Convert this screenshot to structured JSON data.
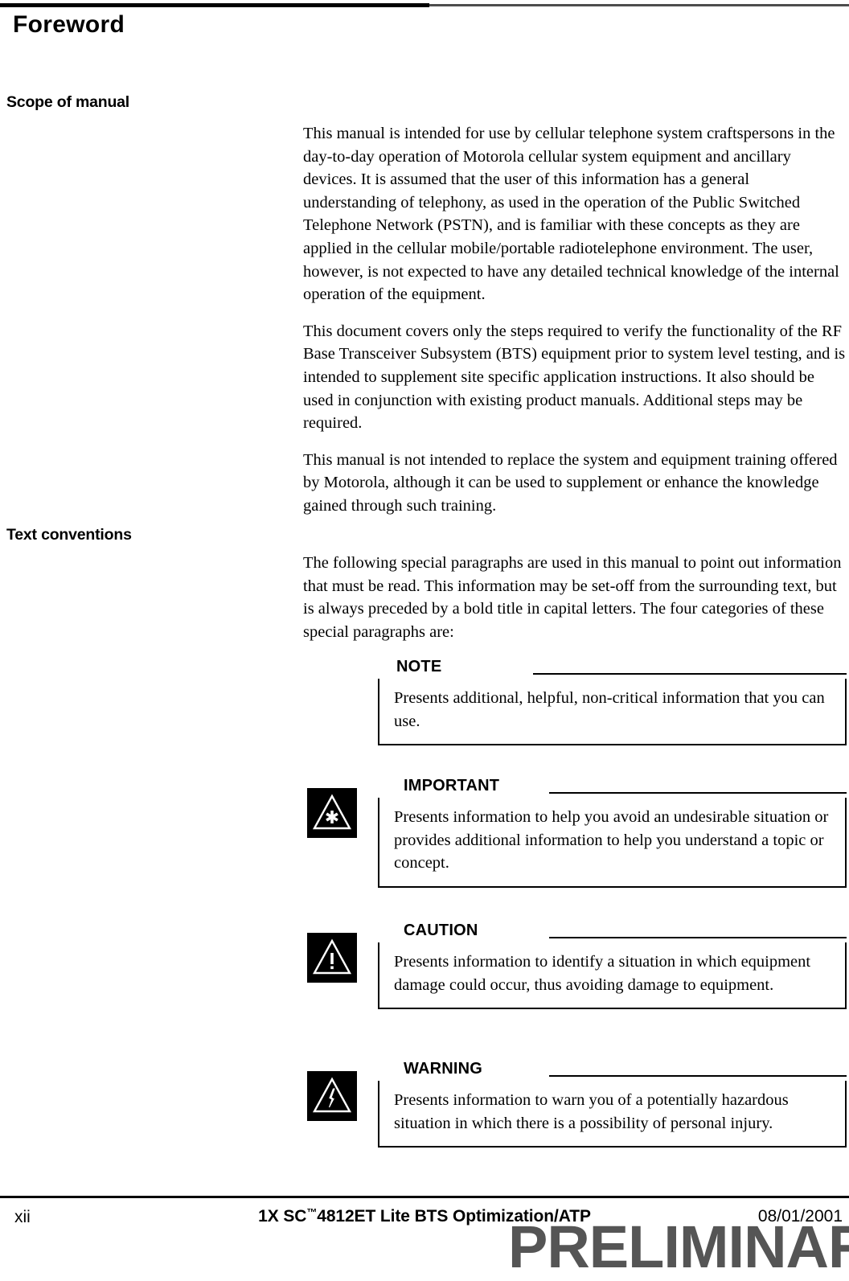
{
  "page": {
    "title": "Foreword",
    "page_number": "xii"
  },
  "sections": [
    {
      "heading": "Scope of manual",
      "paragraphs": [
        "This manual is intended for use by cellular telephone system craftspersons in the day-to-day operation of Motorola cellular system equipment and ancillary devices. It is assumed that the user of this information has a general understanding of telephony, as used in the operation of the Public Switched Telephone Network (PSTN), and is familiar with these concepts as they are applied in the cellular mobile/portable radiotelephone environment. The user, however, is not expected to have any detailed technical knowledge of the internal operation of the equipment.",
        "This document covers only the steps required to verify the functionality of the RF Base Transceiver Subsystem (BTS) equipment prior to system level testing, and is intended to supplement site specific application instructions. It also should be used in conjunction with existing product manuals. Additional steps may be required.",
        "This manual is not intended to replace the system and equipment training offered by Motorola, although it can be used to supplement or enhance the knowledge gained through such training."
      ]
    },
    {
      "heading": "Text conventions",
      "paragraphs": [
        "The following special paragraphs are used in this manual to point out information that must be read. This information may be set-off from the surrounding text, but is always preceded by a bold title in capital letters. The four categories of these special paragraphs are:"
      ]
    }
  ],
  "admonitions": [
    {
      "title": "NOTE",
      "icon": "none",
      "text": "Presents additional, helpful, non-critical information that you can use."
    },
    {
      "title": "IMPORTANT",
      "icon": "triangle-asterisk-icon",
      "text": "Presents information to help you avoid an undesirable situation or provides additional information to help you understand a topic or concept."
    },
    {
      "title": "CAUTION",
      "icon": "triangle-exclamation-icon",
      "text": "Presents information to identify a situation in which equipment damage could occur, thus avoiding damage to equipment."
    },
    {
      "title": "WARNING",
      "icon": "triangle-lightning-icon",
      "text": "Presents information to warn you of a potentially hazardous situation in which there is a possibility of personal injury."
    }
  ],
  "footer": {
    "page_number": "xii",
    "document_title_prefix": "1X SC",
    "document_title_tm": "™",
    "document_title_suffix": "4812ET Lite BTS Optimization/ATP",
    "date": "08/01/2001",
    "watermark": "PRELIMINARY"
  },
  "colors": {
    "rule_black": "#000000",
    "rule_gray": "#4d4d4d",
    "watermark_gray": "#555555"
  }
}
